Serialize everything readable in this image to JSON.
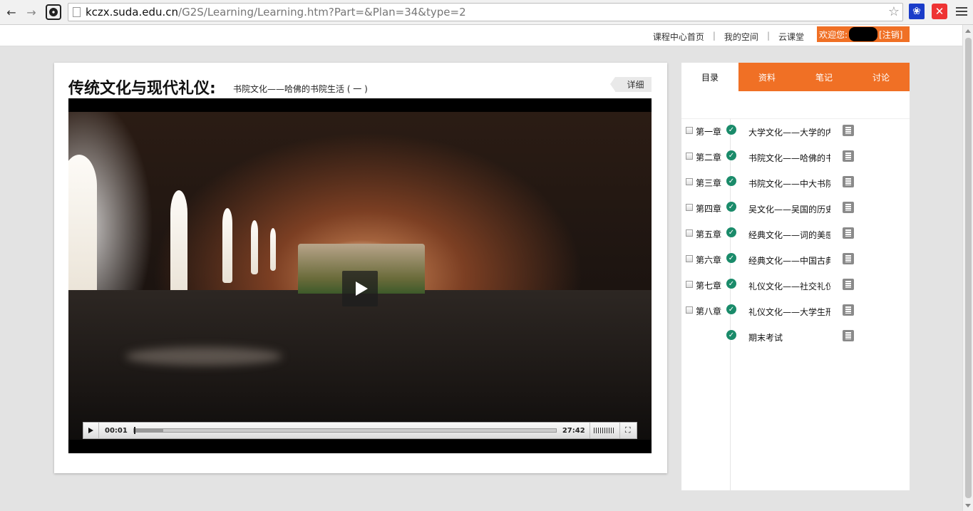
{
  "browser": {
    "url_host": "kczx.suda.edu.cn",
    "url_path": "/G2S/Learning/Learning.htm?Part=&Plan=34&type=2"
  },
  "topbar": {
    "links": [
      "课程中心首页",
      "我的空间",
      "云课堂"
    ],
    "separator": "|",
    "welcome": "欢迎您:",
    "logout": "[注销]"
  },
  "main": {
    "course_title": "传统文化与现代礼仪:",
    "lesson_title": "书院文化——哈佛的书院生活 ( 一 )",
    "detail_button": "详细",
    "player": {
      "current_time": "00:01",
      "duration": "27:42",
      "progress_fraction": 0.0006,
      "buffered_fraction": 0.07
    }
  },
  "sidebar": {
    "tabs": [
      {
        "label": "目录",
        "active": true
      },
      {
        "label": "资料",
        "active": false
      },
      {
        "label": "笔记",
        "active": false
      },
      {
        "label": "讨论",
        "active": false
      }
    ],
    "chapters": [
      {
        "chapter": "第一章",
        "lesson": "大学文化——大学的内",
        "has_checkbox": true
      },
      {
        "chapter": "第二章",
        "lesson": "书院文化——哈佛的书",
        "has_checkbox": true
      },
      {
        "chapter": "第三章",
        "lesson": "书院文化——中大书院",
        "has_checkbox": true
      },
      {
        "chapter": "第四章",
        "lesson": "吴文化——吴国的历史",
        "has_checkbox": true
      },
      {
        "chapter": "第五章",
        "lesson": "经典文化——词的美感",
        "has_checkbox": true
      },
      {
        "chapter": "第六章",
        "lesson": "经典文化——中国古典",
        "has_checkbox": true
      },
      {
        "chapter": "第七章",
        "lesson": "礼仪文化——社交礼仪",
        "has_checkbox": true
      },
      {
        "chapter": "第八章",
        "lesson": "礼仪文化——大学生形",
        "has_checkbox": true
      },
      {
        "chapter": "",
        "lesson": "期末考试",
        "has_checkbox": false
      }
    ]
  },
  "colors": {
    "accent": "#f07025",
    "done": "#1a8b6a"
  }
}
